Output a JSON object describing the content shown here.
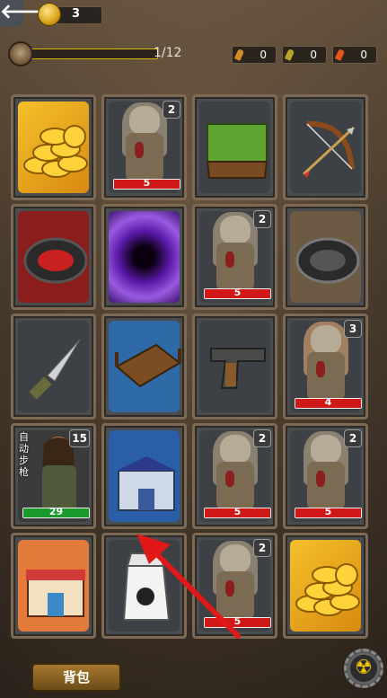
{
  "header": {
    "back_label": "🡐",
    "coins": "3"
  },
  "progress": {
    "text": "1/12",
    "fraction": 0.0833
  },
  "ammo": [
    {
      "value": "0",
      "color": "#d48a2a"
    },
    {
      "value": "0",
      "color": "#b8a52a"
    },
    {
      "value": "0",
      "color": "#e0571d"
    }
  ],
  "cells": [
    {
      "kind": "coins"
    },
    {
      "kind": "zombie",
      "badge": "2",
      "hp": "5"
    },
    {
      "kind": "grass"
    },
    {
      "kind": "bow"
    },
    {
      "kind": "trap-red"
    },
    {
      "kind": "portal"
    },
    {
      "kind": "zombie",
      "badge": "2",
      "hp": "5"
    },
    {
      "kind": "trap-grey"
    },
    {
      "kind": "knife"
    },
    {
      "kind": "bridge"
    },
    {
      "kind": "pistol"
    },
    {
      "kind": "zombie-fur",
      "badge": "3",
      "hp": "4"
    },
    {
      "kind": "survivor",
      "badge": "15",
      "hp": "29",
      "label": "自动步枪"
    },
    {
      "kind": "police"
    },
    {
      "kind": "zombie",
      "badge": "2",
      "hp": "5"
    },
    {
      "kind": "zombie",
      "badge": "2",
      "hp": "5"
    },
    {
      "kind": "shop"
    },
    {
      "kind": "milk"
    },
    {
      "kind": "zombie",
      "badge": "2",
      "hp": "5"
    },
    {
      "kind": "coins"
    }
  ],
  "footer": {
    "backpack_label": "背包",
    "nuke_icon": "☢"
  }
}
